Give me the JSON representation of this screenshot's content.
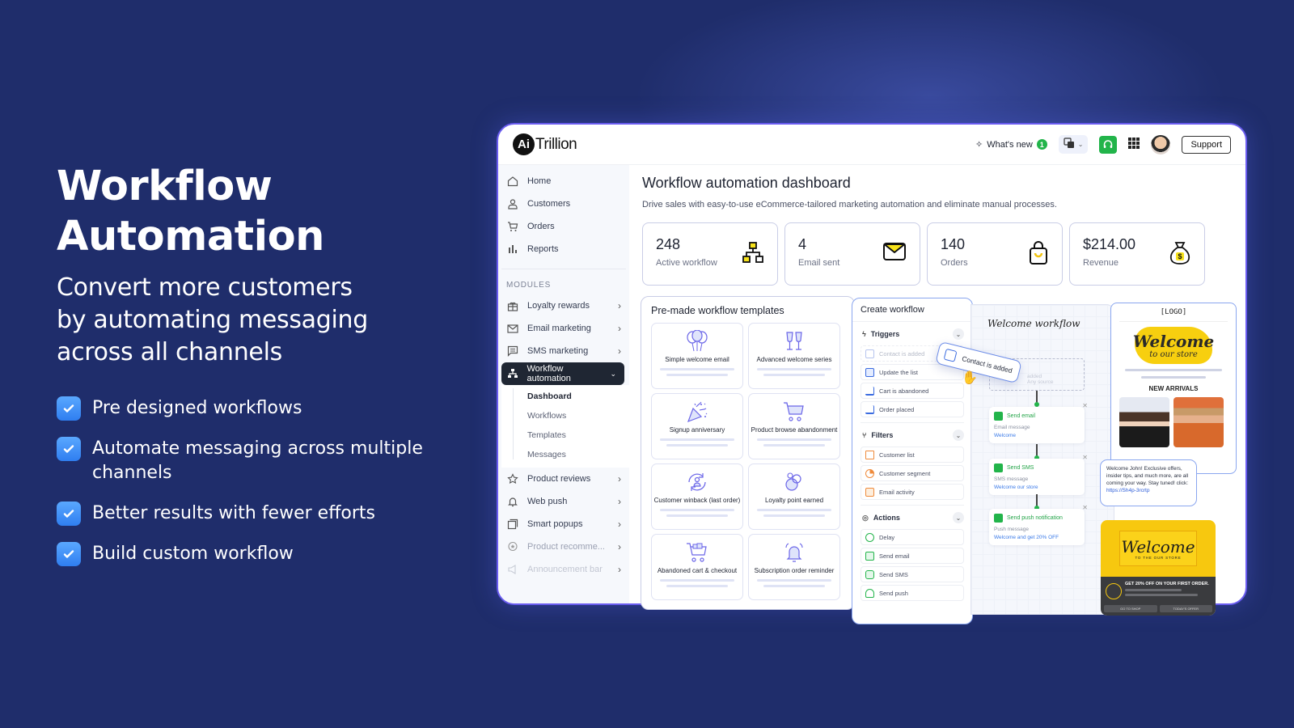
{
  "hero": {
    "title_line1": "Workflow",
    "title_line2": "Automation",
    "subtitle_line1": "Convert more customers",
    "subtitle_line2": "by automating messaging",
    "subtitle_line3": "across all channels",
    "features": [
      "Pre designed workflows",
      "Automate messaging across multiple channels",
      "Better results with fewer efforts",
      "Build custom workflow"
    ]
  },
  "app": {
    "logo_mark": "Ai",
    "logo_word": "Trillion",
    "topbar": {
      "whats_new": "What's new",
      "whats_new_count": "1",
      "support": "Support"
    },
    "sidebar": {
      "main_items": [
        {
          "label": "Home",
          "icon": "home-icon"
        },
        {
          "label": "Customers",
          "icon": "user-icon"
        },
        {
          "label": "Orders",
          "icon": "cart-icon"
        },
        {
          "label": "Reports",
          "icon": "bar-chart-icon"
        }
      ],
      "modules_label": "MODULES",
      "modules": [
        {
          "label": "Loyalty rewards",
          "icon": "gift-icon"
        },
        {
          "label": "Email marketing",
          "icon": "mail-icon"
        },
        {
          "label": "SMS marketing",
          "icon": "message-icon"
        },
        {
          "label": "Workflow automation",
          "icon": "sitemap-icon",
          "active": true
        },
        {
          "label": "Product reviews",
          "icon": "star-icon"
        },
        {
          "label": "Web push",
          "icon": "bell-icon"
        },
        {
          "label": "Smart popups",
          "icon": "popup-icon"
        },
        {
          "label": "Product recomme...",
          "icon": "badge-star-icon"
        },
        {
          "label": "Announcement bar",
          "icon": "megaphone-icon"
        }
      ],
      "workflow_subitems": [
        "Dashboard",
        "Workflows",
        "Templates",
        "Messages"
      ],
      "current_subitem": "Dashboard"
    },
    "main": {
      "title": "Workflow automation dashboard",
      "description": "Drive sales with easy-to-use eCommerce-tailored marketing automation and eliminate manual processes.",
      "stats": [
        {
          "value": "248",
          "label": "Active workflow",
          "icon": "workflow-icon"
        },
        {
          "value": "4",
          "label": "Email sent",
          "icon": "envelope-icon"
        },
        {
          "value": "140",
          "label": "Orders",
          "icon": "shopping-bag-icon"
        },
        {
          "value": "$214.00",
          "label": "Revenue",
          "icon": "money-bag-icon"
        }
      ]
    }
  },
  "templates": {
    "title": "Pre-made workflow templates",
    "items": [
      {
        "label": "Simple welcome email",
        "icon": "balloons-icon"
      },
      {
        "label": "Advanced welcome series",
        "icon": "champagne-icon"
      },
      {
        "label": "Signup anniversary",
        "icon": "party-popper-icon"
      },
      {
        "label": "Product browse abandonment",
        "icon": "cart-icon"
      },
      {
        "label": "Customer winback (last order)",
        "icon": "user-refresh-icon"
      },
      {
        "label": "Loyalty point earned",
        "icon": "coins-icon"
      },
      {
        "label": "Abandoned cart & checkout",
        "icon": "full-cart-icon"
      },
      {
        "label": "Subscription order reminder",
        "icon": "bell-ring-icon"
      }
    ]
  },
  "create_workflow": {
    "title": "Create workflow",
    "sections": [
      {
        "name": "Triggers",
        "icon": "lightning-icon",
        "items": [
          {
            "label": "Contact is added",
            "ghost": true
          },
          {
            "label": "Update the list"
          },
          {
            "label": "Cart is abandoned"
          },
          {
            "label": "Order placed"
          }
        ]
      },
      {
        "name": "Filters",
        "icon": "filter-branch-icon",
        "items": [
          {
            "label": "Customer list"
          },
          {
            "label": "Customer segment"
          },
          {
            "label": "Email activity"
          }
        ]
      },
      {
        "name": "Actions",
        "icon": "target-icon",
        "items": [
          {
            "label": "Delay"
          },
          {
            "label": "Send email"
          },
          {
            "label": "Send SMS"
          },
          {
            "label": "Send push"
          }
        ]
      }
    ],
    "drag_chip": "Contact is added"
  },
  "workflow_canvas": {
    "title": "Welcome workflow",
    "ghost_text_1": "added",
    "ghost_text_2": "Any source",
    "nodes": [
      {
        "title": "Send email",
        "label": "Email message",
        "value": "Welcome"
      },
      {
        "title": "Send SMS",
        "label": "SMS message",
        "value": "Welcome our store"
      },
      {
        "title": "Send push notification",
        "label": "Push message",
        "value": "Welcome and get 20% OFF"
      }
    ]
  },
  "email_preview": {
    "logo": "[LOGO]",
    "headline": "Welcome",
    "tagline": "to our store",
    "section": "NEW ARRIVALS"
  },
  "sms_preview": {
    "text": "Welcome John! Exclusive offers, insider tips, and much more, are all coming your way. Stay tuned! click:",
    "link": "https://Sh4p-3rcrtp"
  },
  "push_preview": {
    "headline": "Welcome",
    "subline": "TO THE OUR STORE",
    "offer": "GET 20% OFF ON YOUR FIRST ORDER.",
    "button1": "GO TO SHOP",
    "button2": "TODAY'S OFFER"
  }
}
